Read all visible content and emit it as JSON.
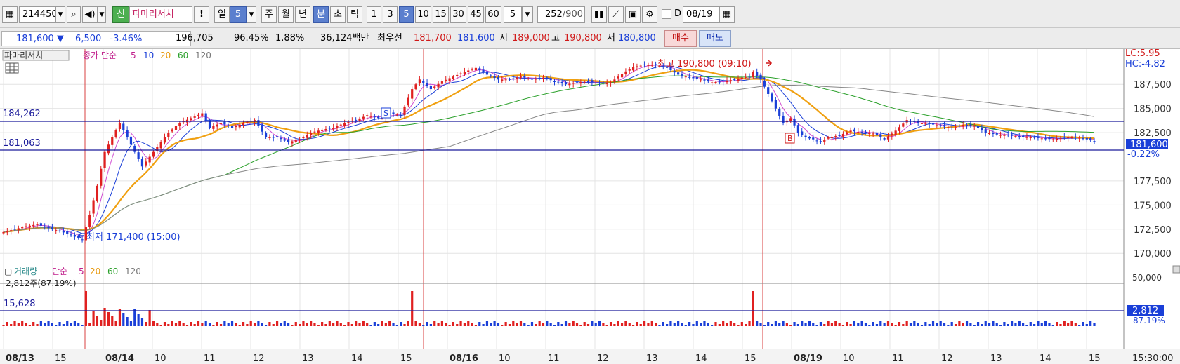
{
  "toolbar": {
    "stock_code": "214450",
    "stock_badge": "신",
    "stock_name": "파마리서치",
    "alert": "!",
    "period_day": "일",
    "period_day_value": "5",
    "period_week": "주",
    "period_month": "월",
    "period_year": "년",
    "period_minute": "분",
    "period_second": "초",
    "period_tick": "틱",
    "minute_options": [
      "1",
      "3",
      "5",
      "10",
      "15",
      "30",
      "45",
      "60"
    ],
    "minute_selected": "5",
    "custom_minute": "5",
    "count_value": "252",
    "count_total": "/900",
    "d_label": "D",
    "date_value": "08/19"
  },
  "quote": {
    "price": "181,600",
    "direction_icon": "down-triangle",
    "change": "6,500",
    "change_rate": "-3.46%",
    "volume": "196,705",
    "volume_ratio": "96.45%",
    "turnover_ratio": "1.88%",
    "amount": "36,124백만",
    "best_label": "최우선",
    "best_ask": "181,700",
    "best_bid": "181,600",
    "open_label": "시",
    "open": "189,000",
    "high_label": "고",
    "high": "190,800",
    "low_label": "저",
    "low": "180,800",
    "buy_button": "매수",
    "sell_button": "매도"
  },
  "price_panel": {
    "name_tag": "파마리서치",
    "ma_label": "종가 단순",
    "ma_periods": [
      "5",
      "10",
      "20",
      "60",
      "120"
    ],
    "ma_colors": [
      "#d04ad0",
      "#1a3fd8",
      "#f0a010",
      "#2aa02a",
      "#888888"
    ],
    "lc": "LC:5.95",
    "hc": "HC:-4.82",
    "ref_line_upper": "184,262",
    "ref_line_lower": "181,063",
    "current_price_tag": "181,600",
    "current_rate_tag": "-0.22%",
    "high_annotation": "최고 190,800 (09:10)",
    "low_annotation": "최저 171,400 (15:00)",
    "signal_s": "S",
    "signal_b": "B",
    "y_ticks": [
      "187,500",
      "185,000",
      "182,500",
      "177,500",
      "175,000",
      "172,500",
      "170,000"
    ]
  },
  "volume_panel": {
    "label": "거래량",
    "ma_label": "단순",
    "ma_periods": [
      "5",
      "20",
      "60",
      "120"
    ],
    "last_volume_info": "2,812주(87.19%)",
    "ref_line": "15,628",
    "y_tick": "50,000",
    "current_volume_tag": "2,812",
    "current_ratio_tag": "87.19%"
  },
  "x_axis": {
    "labels": [
      "08/13",
      "15",
      "08/14",
      "10",
      "11",
      "12",
      "13",
      "14",
      "15",
      "08/16",
      "10",
      "11",
      "12",
      "13",
      "14",
      "15",
      "08/19",
      "10",
      "11",
      "12",
      "13",
      "14",
      "15"
    ],
    "time": "15:30:00"
  },
  "chart_data": {
    "type": "candlestick",
    "interval": "5-minute",
    "days": [
      "08/13",
      "08/14",
      "08/16",
      "08/19"
    ],
    "y_range": [
      169000,
      191000
    ],
    "high": {
      "value": 190800,
      "time": "08/19 09:10"
    },
    "low": {
      "value": 171400,
      "time": "08/14 15:00"
    },
    "close": 181600,
    "reference_lines": [
      184262,
      181063
    ],
    "close_path": [
      [
        0,
        172200
      ],
      [
        3,
        172500
      ],
      [
        6,
        172800
      ],
      [
        9,
        173000
      ],
      [
        12,
        172600
      ],
      [
        15,
        172300
      ],
      [
        18,
        171900
      ],
      [
        21,
        171400
      ],
      [
        23,
        174000
      ],
      [
        25,
        177000
      ],
      [
        27,
        180500
      ],
      [
        29,
        182000
      ],
      [
        31,
        183500
      ],
      [
        33,
        182000
      ],
      [
        35,
        180500
      ],
      [
        37,
        179000
      ],
      [
        39,
        180000
      ],
      [
        41,
        181000
      ],
      [
        44,
        182500
      ],
      [
        47,
        183500
      ],
      [
        50,
        184000
      ],
      [
        53,
        184500
      ],
      [
        55,
        183000
      ],
      [
        58,
        183500
      ],
      [
        61,
        183000
      ],
      [
        64,
        183500
      ],
      [
        67,
        183800
      ],
      [
        70,
        182000
      ],
      [
        73,
        182000
      ],
      [
        76,
        181500
      ],
      [
        79,
        181800
      ],
      [
        82,
        182500
      ],
      [
        85,
        182800
      ],
      [
        88,
        183000
      ],
      [
        91,
        183500
      ],
      [
        94,
        183800
      ],
      [
        97,
        184300
      ],
      [
        100,
        184000
      ],
      [
        103,
        184500
      ],
      [
        106,
        184300
      ],
      [
        109,
        187000
      ],
      [
        111,
        188000
      ],
      [
        114,
        187000
      ],
      [
        117,
        187800
      ],
      [
        120,
        188300
      ],
      [
        123,
        188800
      ],
      [
        126,
        189200
      ],
      [
        129,
        188500
      ],
      [
        132,
        188000
      ],
      [
        135,
        188000
      ],
      [
        138,
        188300
      ],
      [
        141,
        188000
      ],
      [
        144,
        188200
      ],
      [
        147,
        187800
      ],
      [
        150,
        187500
      ],
      [
        153,
        187700
      ],
      [
        156,
        187800
      ],
      [
        159,
        187600
      ],
      [
        162,
        187700
      ],
      [
        165,
        188600
      ],
      [
        168,
        189300
      ],
      [
        171,
        189500
      ],
      [
        174,
        189500
      ],
      [
        177,
        189200
      ],
      [
        180,
        188500
      ],
      [
        183,
        188200
      ],
      [
        186,
        188000
      ],
      [
        189,
        187700
      ],
      [
        192,
        187800
      ],
      [
        195,
        188000
      ],
      [
        197,
        188200
      ],
      [
        199,
        188300
      ],
      [
        200,
        188800
      ],
      [
        202,
        188000
      ],
      [
        204,
        186500
      ],
      [
        206,
        185000
      ],
      [
        208,
        183500
      ],
      [
        210,
        184000
      ],
      [
        212,
        182500
      ],
      [
        214,
        182000
      ],
      [
        216,
        181800
      ],
      [
        218,
        181500
      ],
      [
        220,
        182000
      ],
      [
        223,
        182200
      ],
      [
        226,
        182700
      ],
      [
        229,
        182500
      ],
      [
        232,
        182400
      ],
      [
        235,
        181800
      ],
      [
        238,
        182700
      ],
      [
        241,
        183800
      ],
      [
        244,
        183500
      ],
      [
        247,
        183400
      ],
      [
        250,
        183200
      ],
      [
        253,
        183000
      ],
      [
        256,
        183300
      ],
      [
        259,
        183200
      ],
      [
        262,
        182500
      ],
      [
        265,
        182300
      ],
      [
        268,
        182200
      ],
      [
        271,
        182100
      ],
      [
        274,
        182000
      ],
      [
        277,
        181900
      ],
      [
        280,
        181800
      ],
      [
        283,
        182000
      ],
      [
        286,
        182000
      ],
      [
        288,
        181900
      ],
      [
        290,
        181700
      ],
      [
        291,
        181600
      ]
    ]
  }
}
